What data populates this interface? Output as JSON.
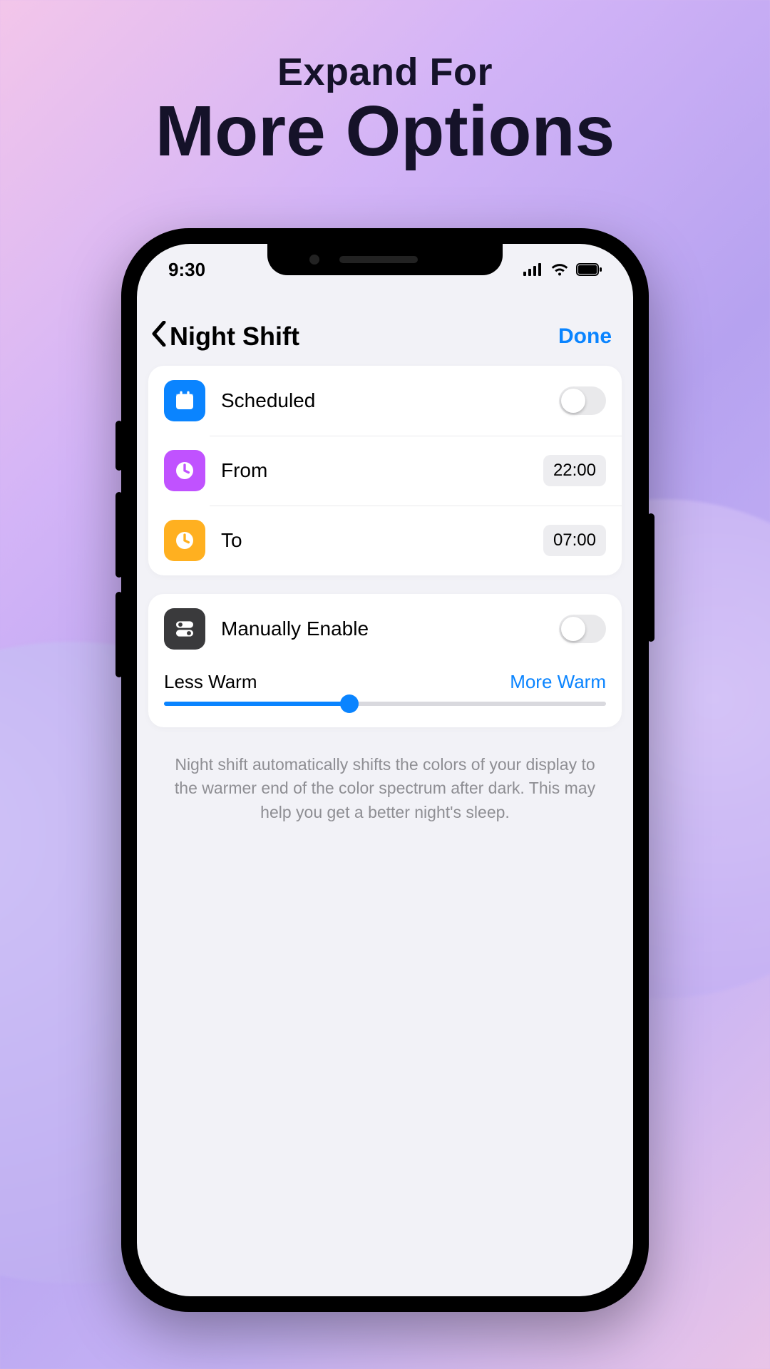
{
  "promo": {
    "line1": "Expand For",
    "line2": "More Options"
  },
  "status": {
    "time": "9:30"
  },
  "nav": {
    "title": "Night Shift",
    "done": "Done"
  },
  "schedule": {
    "scheduled_label": "Scheduled",
    "scheduled_on": false,
    "from_label": "From",
    "from_value": "22:00",
    "to_label": "To",
    "to_value": "07:00"
  },
  "manual": {
    "label": "Manually Enable",
    "enabled": false
  },
  "warmth": {
    "less_label": "Less Warm",
    "more_label": "More Warm",
    "value_percent": 42
  },
  "footer": "Night shift automatically shifts the colors of your display to the warmer end of the color spectrum after dark. This may help you get a better night's sleep.",
  "colors": {
    "accent": "#0a84ff"
  }
}
